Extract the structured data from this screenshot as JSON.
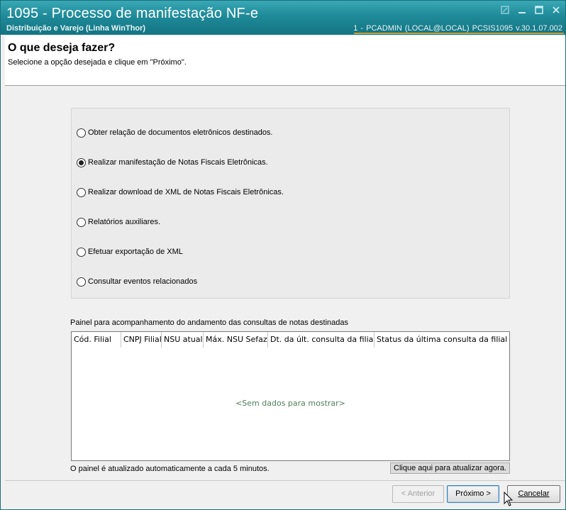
{
  "window": {
    "title": "1095 - Processo de manifestação NF-e",
    "subtitle": "Distribuição e Varejo (Linha WinThor)",
    "info": "1 - PCADMIN (LOCAL@LOCAL)   PCSIS1095  v.30.1.07.002"
  },
  "header": {
    "title": "O que deseja fazer?",
    "instruction": "Selecione a opção desejada e clique em \"Próximo\"."
  },
  "options": [
    {
      "label": "Obter relação de documentos eletrônicos destinados.",
      "selected": false
    },
    {
      "label": "Realizar manifestação de Notas Fiscais Eletrônicas.",
      "selected": true
    },
    {
      "label": "Realizar download de XML de Notas Fiscais Eletrônicas.",
      "selected": false
    },
    {
      "label": "Relatórios auxiliares.",
      "selected": false
    },
    {
      "label": "Efetuar exportação de XML",
      "selected": false
    },
    {
      "label": "Consultar eventos relacionados",
      "selected": false
    }
  ],
  "monitor": {
    "label": "Painel para acompanhamento do andamento das consultas de notas destinadas",
    "columns": [
      "Cód. Filial",
      "CNPJ Filial",
      "NSU atual",
      "Máx. NSU Sefaz",
      "Dt. da últ. consulta da filial",
      "Status da última consulta da filial"
    ],
    "empty_text": "<Sem dados para mostrar>",
    "auto_refresh_note": "O painel é atualizado automaticamente a cada 5 minutos.",
    "refresh_button": "Clique aqui para atualizar agora."
  },
  "buttons": {
    "back": "< Anterior",
    "next": "Próximo >",
    "cancel": "Cancelar"
  },
  "colors": {
    "titlebar": "#1f8a99",
    "empty_text": "#4f7f59"
  }
}
